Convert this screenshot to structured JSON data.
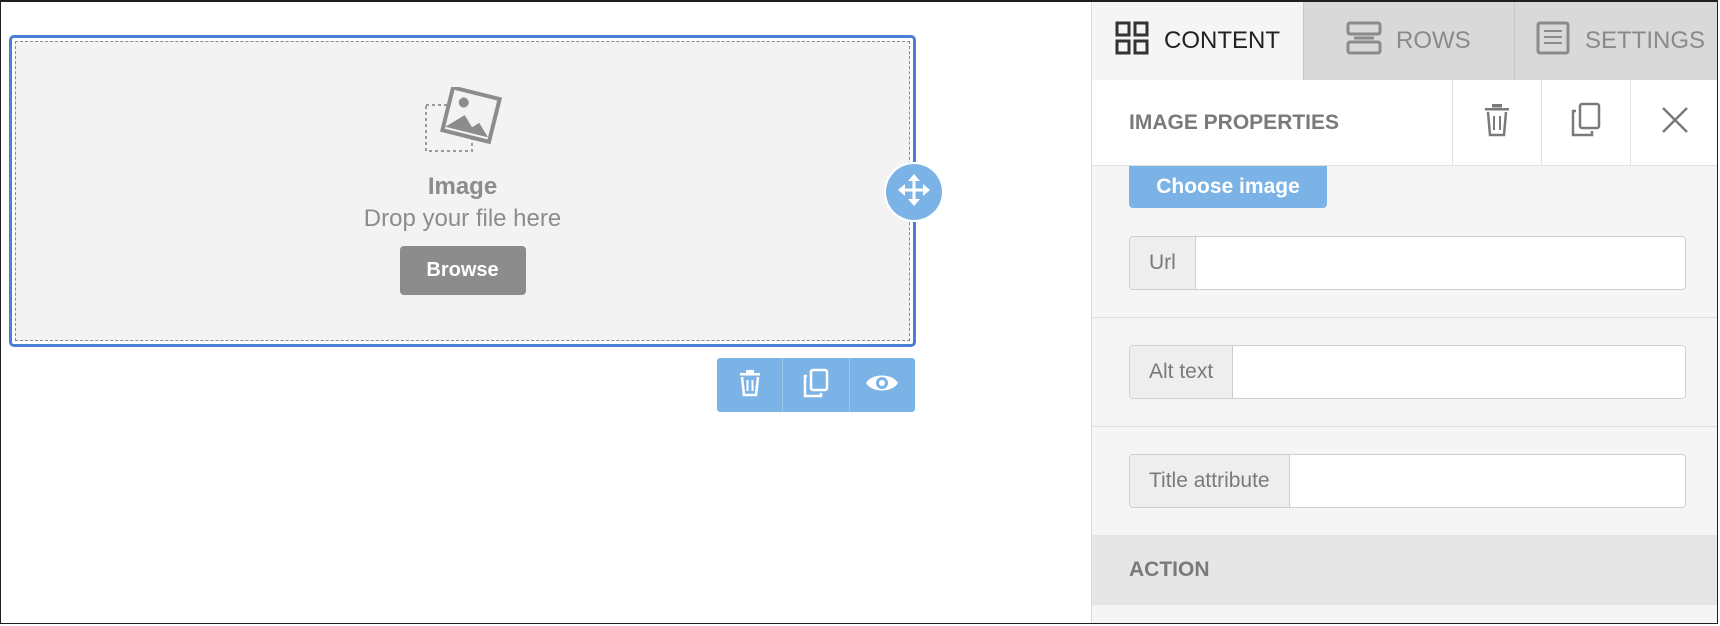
{
  "canvas": {
    "image_block": {
      "title": "Image",
      "subtitle": "Drop your file here",
      "browse_label": "Browse"
    },
    "toolbar": {
      "icons": [
        "trash-icon",
        "duplicate-icon",
        "eye-icon"
      ]
    },
    "move_icon": "move-arrows-icon"
  },
  "panel": {
    "tabs": [
      {
        "label": "CONTENT",
        "icon": "grid-icon",
        "active": true
      },
      {
        "label": "ROWS",
        "icon": "rows-icon",
        "active": false
      },
      {
        "label": "SETTINGS",
        "icon": "document-icon",
        "active": false
      }
    ],
    "header": {
      "title": "IMAGE PROPERTIES",
      "actions": [
        "trash-icon",
        "duplicate-icon",
        "close-icon"
      ]
    },
    "choose_image_label": "Choose image",
    "fields": {
      "url": {
        "label": "Url",
        "value": ""
      },
      "alt": {
        "label": "Alt text",
        "value": ""
      },
      "title": {
        "label": "Title attribute",
        "value": ""
      }
    },
    "action_section": "ACTION"
  },
  "colors": {
    "accent": "#7cb3e6",
    "selection_border": "#4a7fd8",
    "muted_gray": "#8c8c8c"
  }
}
